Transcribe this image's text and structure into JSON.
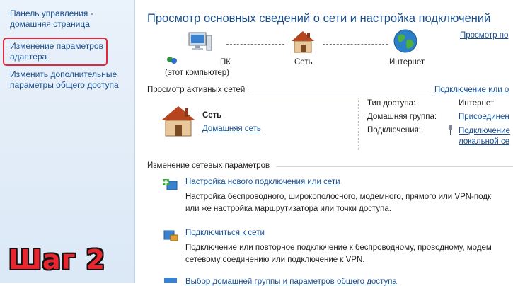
{
  "sidebar": {
    "home_line1": "Панель управления -",
    "home_line2": "домашняя страница",
    "adapter_line1": "Изменение параметров",
    "adapter_line2": "адаптера",
    "sharing_line1": "Изменить дополнительные",
    "sharing_line2": "параметры общего доступа"
  },
  "overlay": {
    "step_label": "Шаг 2",
    "highlight_color": "#e2263b"
  },
  "header": {
    "title": "Просмотр основных сведений о сети и настройка подключений",
    "view_full_map": "Просмотр по"
  },
  "network_map": {
    "computer_label": "ПК",
    "computer_sublabel": "(этот компьютер)",
    "network_label": "Сеть",
    "internet_label": "Интернет",
    "icons": [
      "computer-icon",
      "house-icon",
      "globe-icon"
    ]
  },
  "active_networks": {
    "header": "Просмотр активных сетей",
    "connect_disconnect": "Подключение или о",
    "network_name": "Сеть",
    "network_type": "Домашняя сеть",
    "access_type_label": "Тип доступа:",
    "access_type_value": "Интернет",
    "homegroup_label": "Домашняя группа:",
    "homegroup_value": "Присоединен",
    "connections_label": "Подключения:",
    "connections_value_line1": "Подключение",
    "connections_value_line2": "локальной се"
  },
  "change_settings": {
    "header": "Изменение сетевых параметров",
    "tasks": [
      {
        "title": "Настройка нового подключения или сети",
        "desc_line1": "Настройка беспроводного, широкополосного, модемного, прямого или VPN-подк",
        "desc_line2": "или же настройка маршрутизатора или точки доступа."
      },
      {
        "title": "Подключиться к сети",
        "desc_line1": "Подключение или повторное подключение к беспроводному, проводному, модем",
        "desc_line2": "сетевому соединению или подключение к VPN."
      },
      {
        "title": "Выбор домашней группы и параметров общего доступа"
      }
    ]
  }
}
